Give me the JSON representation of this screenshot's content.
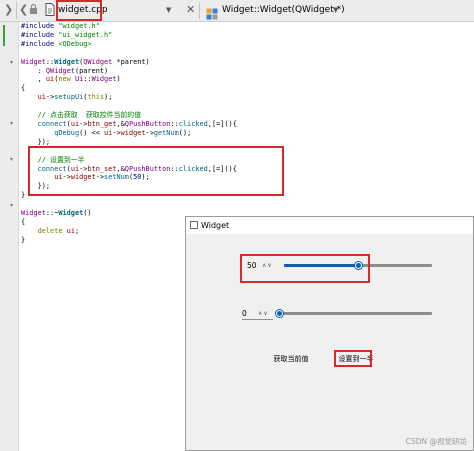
{
  "editor": {
    "file_tab": "widget.cpp",
    "function_dropdown": "Widget::Widget(QWidget *)",
    "toolbar_icons": [
      "split-left-icon",
      "split-right-icon",
      "lock-icon",
      "file-icon",
      "close-icon",
      "function-icon"
    ],
    "code_lines": [
      "#include \"widget.h\"",
      "#include \"ui_widget.h\"",
      "#include <QDebug>",
      "",
      "Widget::Widget(QWidget *parent)",
      "    : QWidget(parent)",
      "    , ui(new Ui::Widget)",
      "{",
      "    ui->setupUi(this);",
      "",
      "    // 点击获取  获取控件当前的值",
      "    connect(ui->btn_get,&QPushButton::clicked,[=](){",
      "        qDebug() << ui->widget->getNum();",
      "    });",
      "",
      "    // 设置到一半",
      "    connect(ui->btn_set,&QPushButton::clicked,[=](){",
      "        ui->widget->setNum(50);",
      "    });",
      "}",
      "",
      "Widget::~Widget()",
      "{",
      "    delete ui;",
      "}"
    ]
  },
  "app_window": {
    "title": "Widget",
    "spinbox1_value": "50",
    "slider1_value": 50,
    "slider_range": [
      0,
      100
    ],
    "spinbox2_value": "0",
    "slider2_value": 0,
    "btn_get_label": "获取当前值",
    "btn_set_label": "设置到一半"
  },
  "watermark": "CSDN @视觉研坊",
  "colors": {
    "highlight_red": "#d42a2a",
    "slider_blue": "#0a5fb4",
    "keyword": "#808000",
    "comment": "#008000",
    "type": "#800080"
  }
}
